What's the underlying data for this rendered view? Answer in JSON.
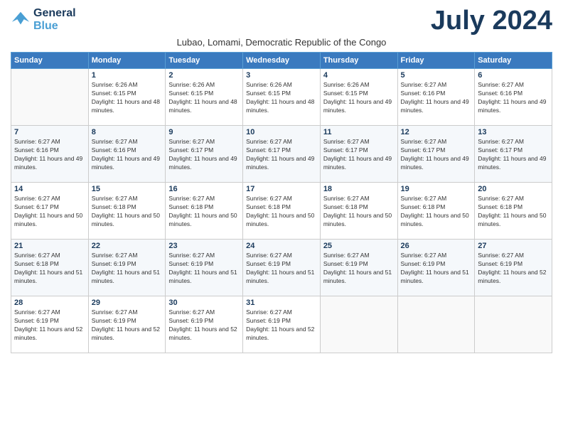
{
  "logo": {
    "line1": "General",
    "line2": "Blue"
  },
  "title": "July 2024",
  "location": "Lubao, Lomami, Democratic Republic of the Congo",
  "days_of_week": [
    "Sunday",
    "Monday",
    "Tuesday",
    "Wednesday",
    "Thursday",
    "Friday",
    "Saturday"
  ],
  "weeks": [
    [
      {
        "day": "",
        "sunrise": "",
        "sunset": "",
        "daylight": ""
      },
      {
        "day": "1",
        "sunrise": "Sunrise: 6:26 AM",
        "sunset": "Sunset: 6:15 PM",
        "daylight": "Daylight: 11 hours and 48 minutes."
      },
      {
        "day": "2",
        "sunrise": "Sunrise: 6:26 AM",
        "sunset": "Sunset: 6:15 PM",
        "daylight": "Daylight: 11 hours and 48 minutes."
      },
      {
        "day": "3",
        "sunrise": "Sunrise: 6:26 AM",
        "sunset": "Sunset: 6:15 PM",
        "daylight": "Daylight: 11 hours and 48 minutes."
      },
      {
        "day": "4",
        "sunrise": "Sunrise: 6:26 AM",
        "sunset": "Sunset: 6:15 PM",
        "daylight": "Daylight: 11 hours and 49 minutes."
      },
      {
        "day": "5",
        "sunrise": "Sunrise: 6:27 AM",
        "sunset": "Sunset: 6:16 PM",
        "daylight": "Daylight: 11 hours and 49 minutes."
      },
      {
        "day": "6",
        "sunrise": "Sunrise: 6:27 AM",
        "sunset": "Sunset: 6:16 PM",
        "daylight": "Daylight: 11 hours and 49 minutes."
      }
    ],
    [
      {
        "day": "7",
        "sunrise": "Sunrise: 6:27 AM",
        "sunset": "Sunset: 6:16 PM",
        "daylight": "Daylight: 11 hours and 49 minutes."
      },
      {
        "day": "8",
        "sunrise": "Sunrise: 6:27 AM",
        "sunset": "Sunset: 6:16 PM",
        "daylight": "Daylight: 11 hours and 49 minutes."
      },
      {
        "day": "9",
        "sunrise": "Sunrise: 6:27 AM",
        "sunset": "Sunset: 6:17 PM",
        "daylight": "Daylight: 11 hours and 49 minutes."
      },
      {
        "day": "10",
        "sunrise": "Sunrise: 6:27 AM",
        "sunset": "Sunset: 6:17 PM",
        "daylight": "Daylight: 11 hours and 49 minutes."
      },
      {
        "day": "11",
        "sunrise": "Sunrise: 6:27 AM",
        "sunset": "Sunset: 6:17 PM",
        "daylight": "Daylight: 11 hours and 49 minutes."
      },
      {
        "day": "12",
        "sunrise": "Sunrise: 6:27 AM",
        "sunset": "Sunset: 6:17 PM",
        "daylight": "Daylight: 11 hours and 49 minutes."
      },
      {
        "day": "13",
        "sunrise": "Sunrise: 6:27 AM",
        "sunset": "Sunset: 6:17 PM",
        "daylight": "Daylight: 11 hours and 49 minutes."
      }
    ],
    [
      {
        "day": "14",
        "sunrise": "Sunrise: 6:27 AM",
        "sunset": "Sunset: 6:17 PM",
        "daylight": "Daylight: 11 hours and 50 minutes."
      },
      {
        "day": "15",
        "sunrise": "Sunrise: 6:27 AM",
        "sunset": "Sunset: 6:18 PM",
        "daylight": "Daylight: 11 hours and 50 minutes."
      },
      {
        "day": "16",
        "sunrise": "Sunrise: 6:27 AM",
        "sunset": "Sunset: 6:18 PM",
        "daylight": "Daylight: 11 hours and 50 minutes."
      },
      {
        "day": "17",
        "sunrise": "Sunrise: 6:27 AM",
        "sunset": "Sunset: 6:18 PM",
        "daylight": "Daylight: 11 hours and 50 minutes."
      },
      {
        "day": "18",
        "sunrise": "Sunrise: 6:27 AM",
        "sunset": "Sunset: 6:18 PM",
        "daylight": "Daylight: 11 hours and 50 minutes."
      },
      {
        "day": "19",
        "sunrise": "Sunrise: 6:27 AM",
        "sunset": "Sunset: 6:18 PM",
        "daylight": "Daylight: 11 hours and 50 minutes."
      },
      {
        "day": "20",
        "sunrise": "Sunrise: 6:27 AM",
        "sunset": "Sunset: 6:18 PM",
        "daylight": "Daylight: 11 hours and 50 minutes."
      }
    ],
    [
      {
        "day": "21",
        "sunrise": "Sunrise: 6:27 AM",
        "sunset": "Sunset: 6:18 PM",
        "daylight": "Daylight: 11 hours and 51 minutes."
      },
      {
        "day": "22",
        "sunrise": "Sunrise: 6:27 AM",
        "sunset": "Sunset: 6:19 PM",
        "daylight": "Daylight: 11 hours and 51 minutes."
      },
      {
        "day": "23",
        "sunrise": "Sunrise: 6:27 AM",
        "sunset": "Sunset: 6:19 PM",
        "daylight": "Daylight: 11 hours and 51 minutes."
      },
      {
        "day": "24",
        "sunrise": "Sunrise: 6:27 AM",
        "sunset": "Sunset: 6:19 PM",
        "daylight": "Daylight: 11 hours and 51 minutes."
      },
      {
        "day": "25",
        "sunrise": "Sunrise: 6:27 AM",
        "sunset": "Sunset: 6:19 PM",
        "daylight": "Daylight: 11 hours and 51 minutes."
      },
      {
        "day": "26",
        "sunrise": "Sunrise: 6:27 AM",
        "sunset": "Sunset: 6:19 PM",
        "daylight": "Daylight: 11 hours and 51 minutes."
      },
      {
        "day": "27",
        "sunrise": "Sunrise: 6:27 AM",
        "sunset": "Sunset: 6:19 PM",
        "daylight": "Daylight: 11 hours and 52 minutes."
      }
    ],
    [
      {
        "day": "28",
        "sunrise": "Sunrise: 6:27 AM",
        "sunset": "Sunset: 6:19 PM",
        "daylight": "Daylight: 11 hours and 52 minutes."
      },
      {
        "day": "29",
        "sunrise": "Sunrise: 6:27 AM",
        "sunset": "Sunset: 6:19 PM",
        "daylight": "Daylight: 11 hours and 52 minutes."
      },
      {
        "day": "30",
        "sunrise": "Sunrise: 6:27 AM",
        "sunset": "Sunset: 6:19 PM",
        "daylight": "Daylight: 11 hours and 52 minutes."
      },
      {
        "day": "31",
        "sunrise": "Sunrise: 6:27 AM",
        "sunset": "Sunset: 6:19 PM",
        "daylight": "Daylight: 11 hours and 52 minutes."
      },
      {
        "day": "",
        "sunrise": "",
        "sunset": "",
        "daylight": ""
      },
      {
        "day": "",
        "sunrise": "",
        "sunset": "",
        "daylight": ""
      },
      {
        "day": "",
        "sunrise": "",
        "sunset": "",
        "daylight": ""
      }
    ]
  ]
}
